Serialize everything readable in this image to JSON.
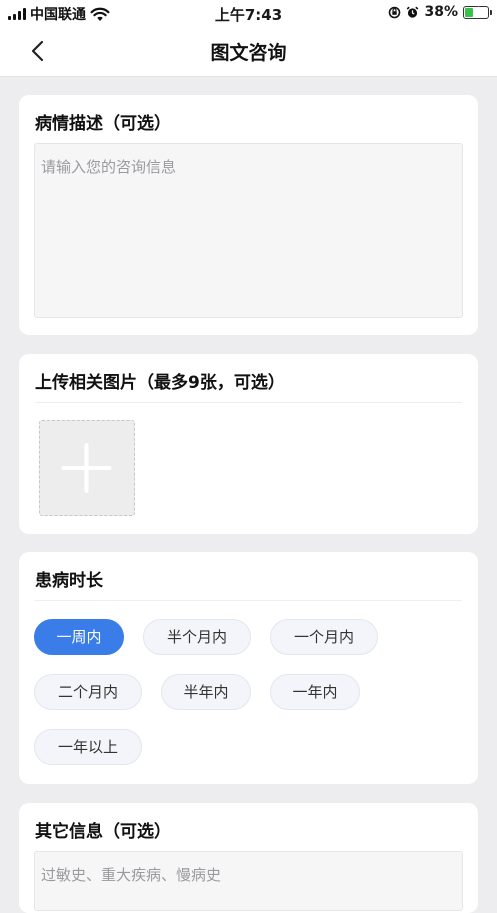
{
  "status_bar": {
    "carrier": "中国联通",
    "time": "上午7:43",
    "battery_percent": "38%",
    "battery_level": 0.38,
    "icons": [
      "signal-icon",
      "wifi-icon",
      "orientation-lock-icon",
      "alarm-icon",
      "battery-charging-icon"
    ]
  },
  "nav": {
    "title": "图文咨询",
    "back_icon": "chevron-left-icon"
  },
  "description": {
    "title": "病情描述（可选）",
    "placeholder": "请输入您的咨询信息",
    "value": ""
  },
  "upload": {
    "title": "上传相关图片（最多9张，可选）",
    "add_icon": "plus-icon"
  },
  "duration": {
    "title": "患病时长",
    "options": [
      "一周内",
      "半个月内",
      "一个月内",
      "二个月内",
      "半年内",
      "一年内",
      "一年以上"
    ],
    "selected": "一周内"
  },
  "other_info": {
    "title": "其它信息（可选）",
    "placeholder": "过敏史、重大疾病、慢病史",
    "value": ""
  },
  "colors": {
    "accent": "#3a7de8",
    "background": "#ededef",
    "card": "#ffffff",
    "charging": "#37c34a"
  }
}
